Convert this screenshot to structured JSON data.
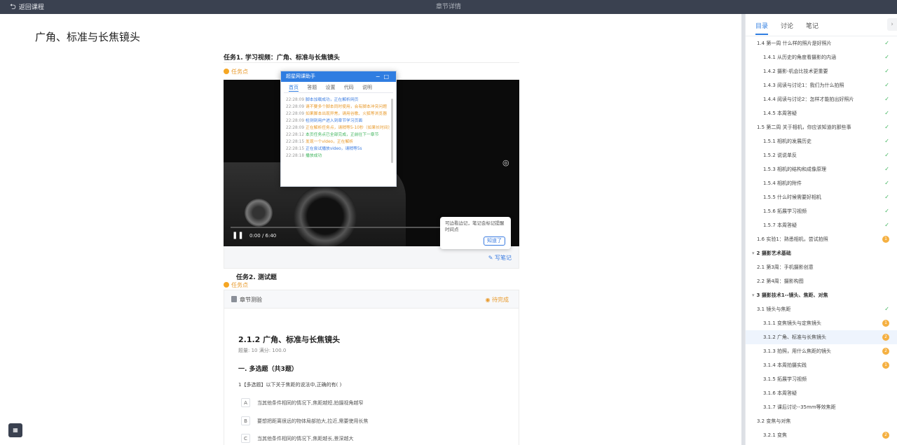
{
  "topbar": {
    "back_label": "返回课程",
    "title": "章节详情"
  },
  "page": {
    "title": "广角、标准与长焦镜头"
  },
  "task1": {
    "title": "任务1. 学习视频：广角、标准与长焦镜头",
    "point_label": "任务点"
  },
  "video": {
    "time": "0:00 / 6:40",
    "note_label": "写笔记",
    "snapshot_icon": "camera-icon"
  },
  "tooltip": {
    "text": "可边看边记，笔记会标记提醒时间点",
    "ok_label": "知道了"
  },
  "helper": {
    "title": "超星网课助手",
    "tabs": [
      "首页",
      "答题",
      "设置",
      "代码",
      "说明"
    ],
    "logs": [
      {
        "time": "22:28:09",
        "text": "脚本加载成功，正在解析网页",
        "color": "#3a7be0"
      },
      {
        "time": "22:28:09",
        "text": "请不要多个脚本同时使用，会有脚本冲突问题",
        "color": "#e89a2c"
      },
      {
        "time": "22:28:09",
        "text": "如果脚本出现异常，请用谷歌、火狐等浏览器",
        "color": "#e89a2c"
      },
      {
        "time": "22:28:09",
        "text": "检测到用户进入到章节学习页面",
        "color": "#3a7be0"
      },
      {
        "time": "22:28:09",
        "text": "正在解析任务点，请稍等5-10秒（如果长时间没有反应，请刷新页面）",
        "color": "#e89a2c"
      },
      {
        "time": "22:28:12",
        "text": "本页任务点已全部完成，正前往下一章节",
        "color": "#3cb35a"
      },
      {
        "time": "22:28:15",
        "text": "发现一个video，正在解析",
        "color": "#e89a2c"
      },
      {
        "time": "22:28:15",
        "text": "正在尝试播放video，请稍等5s",
        "color": "#3a7be0"
      },
      {
        "time": "22:28:18",
        "text": "播放成功",
        "color": "#3cb35a"
      }
    ]
  },
  "task2": {
    "title": "任务2. 测试题",
    "point_label": "任务点"
  },
  "quiz": {
    "header": "章节测验",
    "status": "待完成",
    "title": "2.1.2 广角、标准与长焦镜头",
    "meta": "题量: 10    满分: 100.0",
    "section": "一. 多选题（共3题）",
    "question": "1【多选题】以下关于焦距的说法中,正确的有( )",
    "question_tag": "【多选题】",
    "options": [
      {
        "key": "A",
        "text": "当其他条件相同的情况下,焦距越短,拍摄视角越窄"
      },
      {
        "key": "B",
        "text": "要想把距离很远的物体局部拍大,拉近,需要使用长焦"
      },
      {
        "key": "C",
        "text": "当其他条件相同的情况下,焦距越长,景深越大"
      }
    ]
  },
  "sidebar": {
    "tabs": [
      "目录",
      "讨论",
      "笔记"
    ],
    "items": [
      {
        "label": "1.4 第一周 什么样的照片是好照片",
        "level": "l1",
        "status": "ok"
      },
      {
        "label": "1.4.1 从历史的角度看摄影的内涵",
        "level": "l2",
        "status": "ok"
      },
      {
        "label": "1.4.2 摄影-机会比技术更重要",
        "level": "l2",
        "status": "ok"
      },
      {
        "label": "1.4.3 阅读与讨论1：我们为什么拍照",
        "level": "l2",
        "status": "ok"
      },
      {
        "label": "1.4.4 阅读与讨论2：怎样才能拍出好照片",
        "level": "l2",
        "status": "ok"
      },
      {
        "label": "1.4.5 本周答疑",
        "level": "l2",
        "status": "ok"
      },
      {
        "label": "1.5 第二周 关于相机，你应该知道的那些事",
        "level": "l1",
        "status": "ok"
      },
      {
        "label": "1.5.1 相机的发展历史",
        "level": "l2",
        "status": "ok"
      },
      {
        "label": "1.5.2 说说单反",
        "level": "l2",
        "status": "ok"
      },
      {
        "label": "1.5.3 相机的结构和成像原理",
        "level": "l2",
        "status": "ok"
      },
      {
        "label": "1.5.4 相机的附件",
        "level": "l2",
        "status": "ok"
      },
      {
        "label": "1.5.5 什么时候需要好相机",
        "level": "l2",
        "status": "ok"
      },
      {
        "label": "1.5.6 拓展学习视频",
        "level": "l2",
        "status": "ok"
      },
      {
        "label": "1.5.7 本周答疑",
        "level": "l2",
        "status": "ok"
      },
      {
        "label": "1.6 实验1：熟悉相机，尝试拍照",
        "level": "l1",
        "status": "1"
      },
      {
        "label": "2 摄影艺术基础",
        "level": "chap",
        "status": ""
      },
      {
        "label": "2.1 第3周：手机摄影创意",
        "level": "l1",
        "status": ""
      },
      {
        "label": "2.2 第4周：摄影构图",
        "level": "l1",
        "status": ""
      },
      {
        "label": "3 摄影技术1--镜头、焦距、对焦",
        "level": "chap",
        "status": ""
      },
      {
        "label": "3.1 镜头与焦距",
        "level": "l1",
        "status": "ok"
      },
      {
        "label": "3.1.1 变焦镜头与定焦镜头",
        "level": "l2",
        "status": "1"
      },
      {
        "label": "3.1.2 广角、标准与长焦镜头",
        "level": "l2",
        "status": "2",
        "current": true
      },
      {
        "label": "3.1.3 拍照，用什么焦距的镜头",
        "level": "l2",
        "status": "2"
      },
      {
        "label": "3.1.4 本周拍摄实践",
        "level": "l2",
        "status": "1"
      },
      {
        "label": "3.1.5 拓展学习视频",
        "level": "l2",
        "status": ""
      },
      {
        "label": "3.1.6 本周答疑",
        "level": "l2",
        "status": ""
      },
      {
        "label": "3.1.7 课后讨论--35mm等效焦距",
        "level": "l2",
        "status": ""
      },
      {
        "label": "3.2 变焦与对焦",
        "level": "l1",
        "status": ""
      },
      {
        "label": "3.2.1 变焦",
        "level": "l2",
        "status": "2"
      }
    ]
  },
  "colors": {
    "accent": "#2f7de1",
    "warning": "#f5a623",
    "success": "#3cb35a",
    "topbar": "#3a4150"
  }
}
